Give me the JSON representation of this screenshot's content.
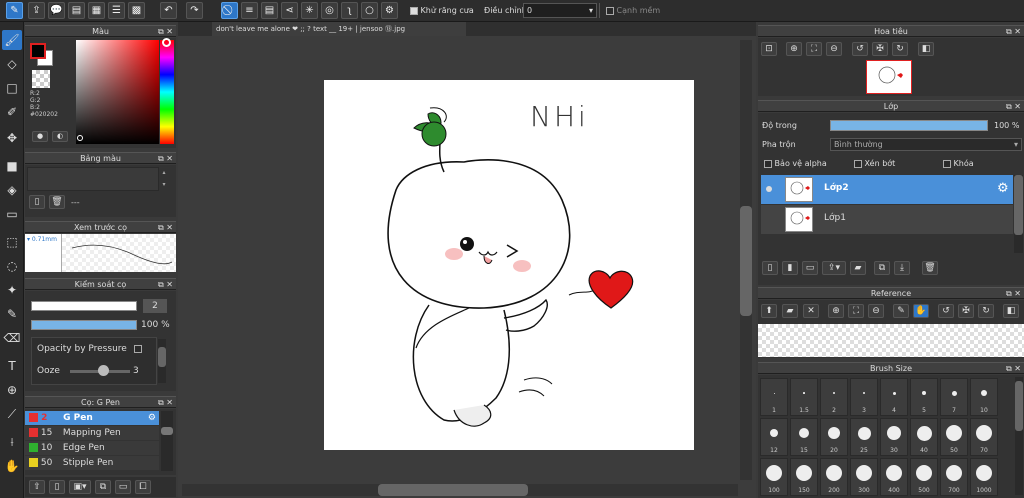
{
  "toolbar": {
    "antialias_label": "Khử răng cưa",
    "adjust_label": "Điều chỉnh",
    "adjust_value": "0",
    "edge_label": "Cạnh mềm"
  },
  "document": {
    "tab_title": "don't leave me alone ❤ ;; ? text __ 19+ | jensoo ⑬.jpg"
  },
  "color_panel": {
    "title": "Màu",
    "r": "R:2",
    "g": "G:2",
    "b": "B:2",
    "hex": "#020202"
  },
  "palette_panel": {
    "title": "Bảng màu",
    "placeholder": "---"
  },
  "preview_panel": {
    "title": "Xem trước cọ",
    "size": "0.71mm"
  },
  "control_panel": {
    "title": "Kiểm soát cọ",
    "size_value": "2",
    "opacity_value": "100",
    "opacity_unit": "%",
    "pressure_label": "Opacity by Pressure",
    "ooze_label": "Ooze",
    "ooze_value": "3"
  },
  "brush_panel": {
    "title": "Cọ: G Pen",
    "items": [
      {
        "size": "2",
        "name": "G Pen",
        "color": "#e53030"
      },
      {
        "size": "15",
        "name": "Mapping Pen",
        "color": "#e53030"
      },
      {
        "size": "10",
        "name": "Edge Pen",
        "color": "#2fb02f"
      },
      {
        "size": "50",
        "name": "Stipple Pen",
        "color": "#e8d020"
      }
    ]
  },
  "navigator": {
    "title": "Hoa tiêu"
  },
  "layers": {
    "title": "Lớp",
    "opacity_label": "Độ trong",
    "opacity_value": "100 %",
    "blend_label": "Pha trộn",
    "blend_value": "Bình thường",
    "protect_alpha": "Bảo vệ alpha",
    "clipping": "Xén bớt",
    "lock": "Khóa",
    "items": [
      {
        "name": "Lớp2"
      },
      {
        "name": "Lớp1"
      }
    ]
  },
  "reference": {
    "title": "Reference"
  },
  "brush_size": {
    "title": "Brush Size",
    "sizes": [
      "1",
      "1.5",
      "2",
      "3",
      "4",
      "5",
      "7",
      "10",
      "12",
      "15",
      "20",
      "25",
      "30",
      "40",
      "50",
      "70",
      "100",
      "150",
      "200",
      "300",
      "400",
      "500",
      "700",
      "1000"
    ]
  },
  "canvas_text": {
    "handwriting": "NHi"
  },
  "colors": {
    "accent": "#2e77c8",
    "heart": "#e01818",
    "leaf": "#2e8b2e"
  }
}
